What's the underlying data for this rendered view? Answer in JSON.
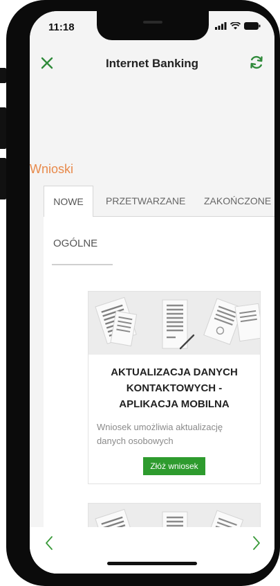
{
  "status_bar": {
    "time": "11:18"
  },
  "header": {
    "title": "Internet Banking"
  },
  "section": {
    "title": "Wnioski"
  },
  "tabs": [
    {
      "label": "NOWE",
      "active": true
    },
    {
      "label": "PRZETWARZANE",
      "active": false
    },
    {
      "label": "ZAKOŃCZONE",
      "active": false
    }
  ],
  "subtab": {
    "label": "OGÓLNE"
  },
  "cards": [
    {
      "title": "AKTUALIZACJA DANYCH KONTAKTOWYCH - APLIKACJA MOBILNA",
      "description": "Wniosek umożliwia aktualizację danych osobowych",
      "button": "Złóż wniosek"
    }
  ],
  "colors": {
    "accent_orange": "#e8894a",
    "brand_green": "#2e9b2e",
    "icon_green": "#2f8a3a"
  }
}
